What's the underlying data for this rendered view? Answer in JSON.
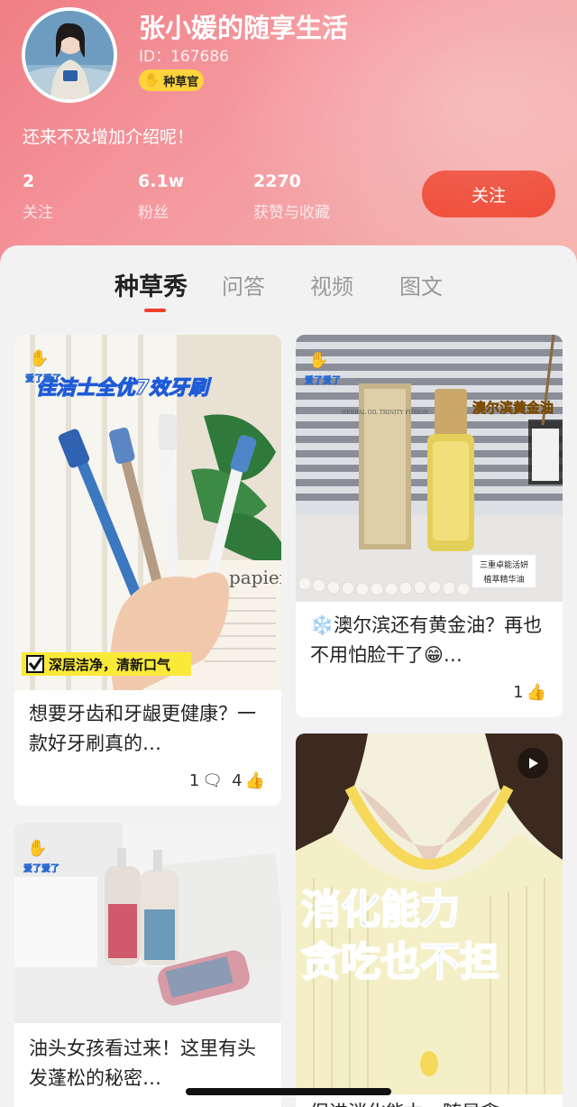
{
  "profile": {
    "name": "张小媛的随享生活",
    "id": "ID：167686",
    "badge": "种草官",
    "bio": "还来不及增加介绍呢！",
    "stats": [
      {
        "value": "2",
        "label": "关注"
      },
      {
        "value": "6.1w",
        "label": "粉丝"
      },
      {
        "value": "2270",
        "label": "获赞与收藏"
      }
    ],
    "follow_label": "关注"
  },
  "tabs": [
    "种草秀",
    "问答",
    "视频",
    "图文"
  ],
  "active_tab": "种草秀",
  "posts": [
    {
      "title": "想要牙齿和牙龈更健康？一款好牙刷真的…",
      "comments": "1",
      "likes": "4",
      "sticker_top": "爱了爱了",
      "overlay_title": "佳洁士全优7效牙刷",
      "overlay_caption": "深层洁净，清新口气",
      "paper_text": "papier"
    },
    {
      "title": "澳尔滨还有黄金油？再也不用怕脸干了😁…",
      "emoji_prefix": "❄️",
      "likes": "1",
      "sticker_top": "爱了爱了",
      "overlay_title": "澳尔滨黄金油",
      "label_lines": [
        "三重卓能活妍",
        "植萃精华油"
      ],
      "box_text": "HERBAL OIL TRINITY FUSION"
    },
    {
      "title": "油头女孩看过来！这里有头发蓬松的秘密…",
      "sticker_top": "爱了爱了"
    },
    {
      "overlay_lines": [
        "消化能力",
        "贪吃也不担"
      ],
      "title_partial": "促进消化能力，随显贪"
    }
  ],
  "colors": {
    "accent": "#ee3f2a",
    "badge": "#ffd33b"
  }
}
